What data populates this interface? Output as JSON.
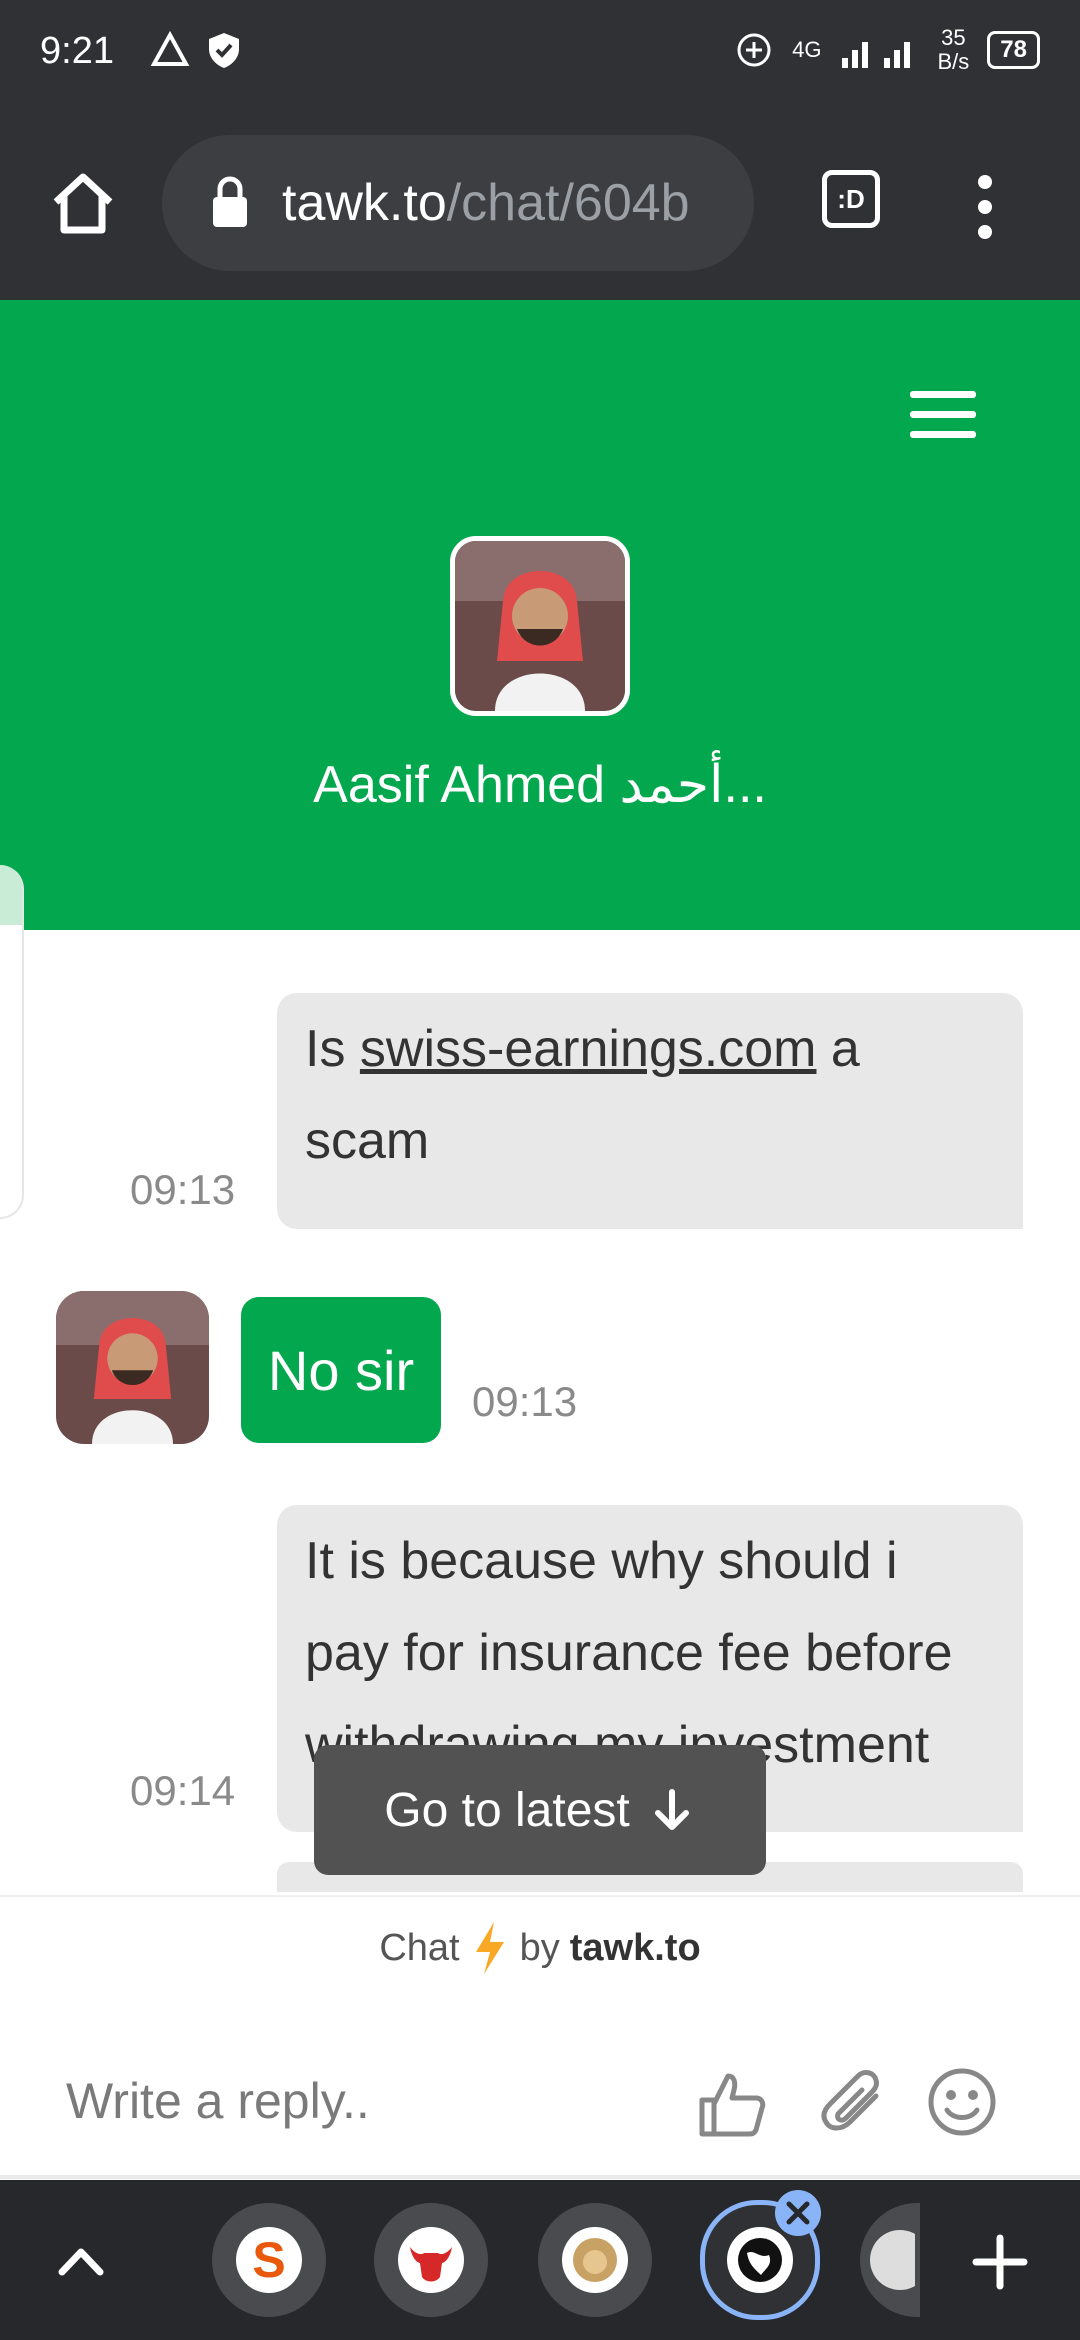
{
  "status_bar": {
    "time": "9:21",
    "network_type": "4G",
    "speed": "35",
    "speed_unit": "B/s",
    "battery": "78"
  },
  "browser": {
    "url_domain": "tawk.to",
    "url_path": "/chat/604b",
    "tab_switcher_label": ":D"
  },
  "header": {
    "agent_name": "Aasif Ahmed أحمد..."
  },
  "messages": [
    {
      "sender": "visitor",
      "text_before_link": "Is ",
      "link_text": "swiss-earnings.com",
      "text_after_link": " a scam",
      "time": "09:13"
    },
    {
      "sender": "agent",
      "text": "No sir",
      "time": "09:13"
    },
    {
      "sender": "visitor",
      "text": "It is because why should i pay for insurance fee before withdrawing my investment",
      "time": "09:14"
    }
  ],
  "go_to_latest": "Go to latest",
  "powered_by": {
    "chat": "Chat",
    "by": "by",
    "brand": "tawk.to"
  },
  "reply": {
    "placeholder": "Write a reply.."
  },
  "colors": {
    "brand_green": "#03a84e",
    "bubble_gray": "#e8e8e8",
    "bar_dark": "#303134"
  },
  "bottom_tabs": [
    {
      "icon": "s-letter-icon",
      "color": "#e8590c"
    },
    {
      "icon": "bull-icon",
      "color": "#d62828"
    },
    {
      "icon": "lion-icon",
      "color": "#c8a165"
    },
    {
      "icon": "globe-icon",
      "color": "#111111"
    },
    {
      "icon": "partial-tab-icon",
      "color": "#cccccc"
    }
  ]
}
